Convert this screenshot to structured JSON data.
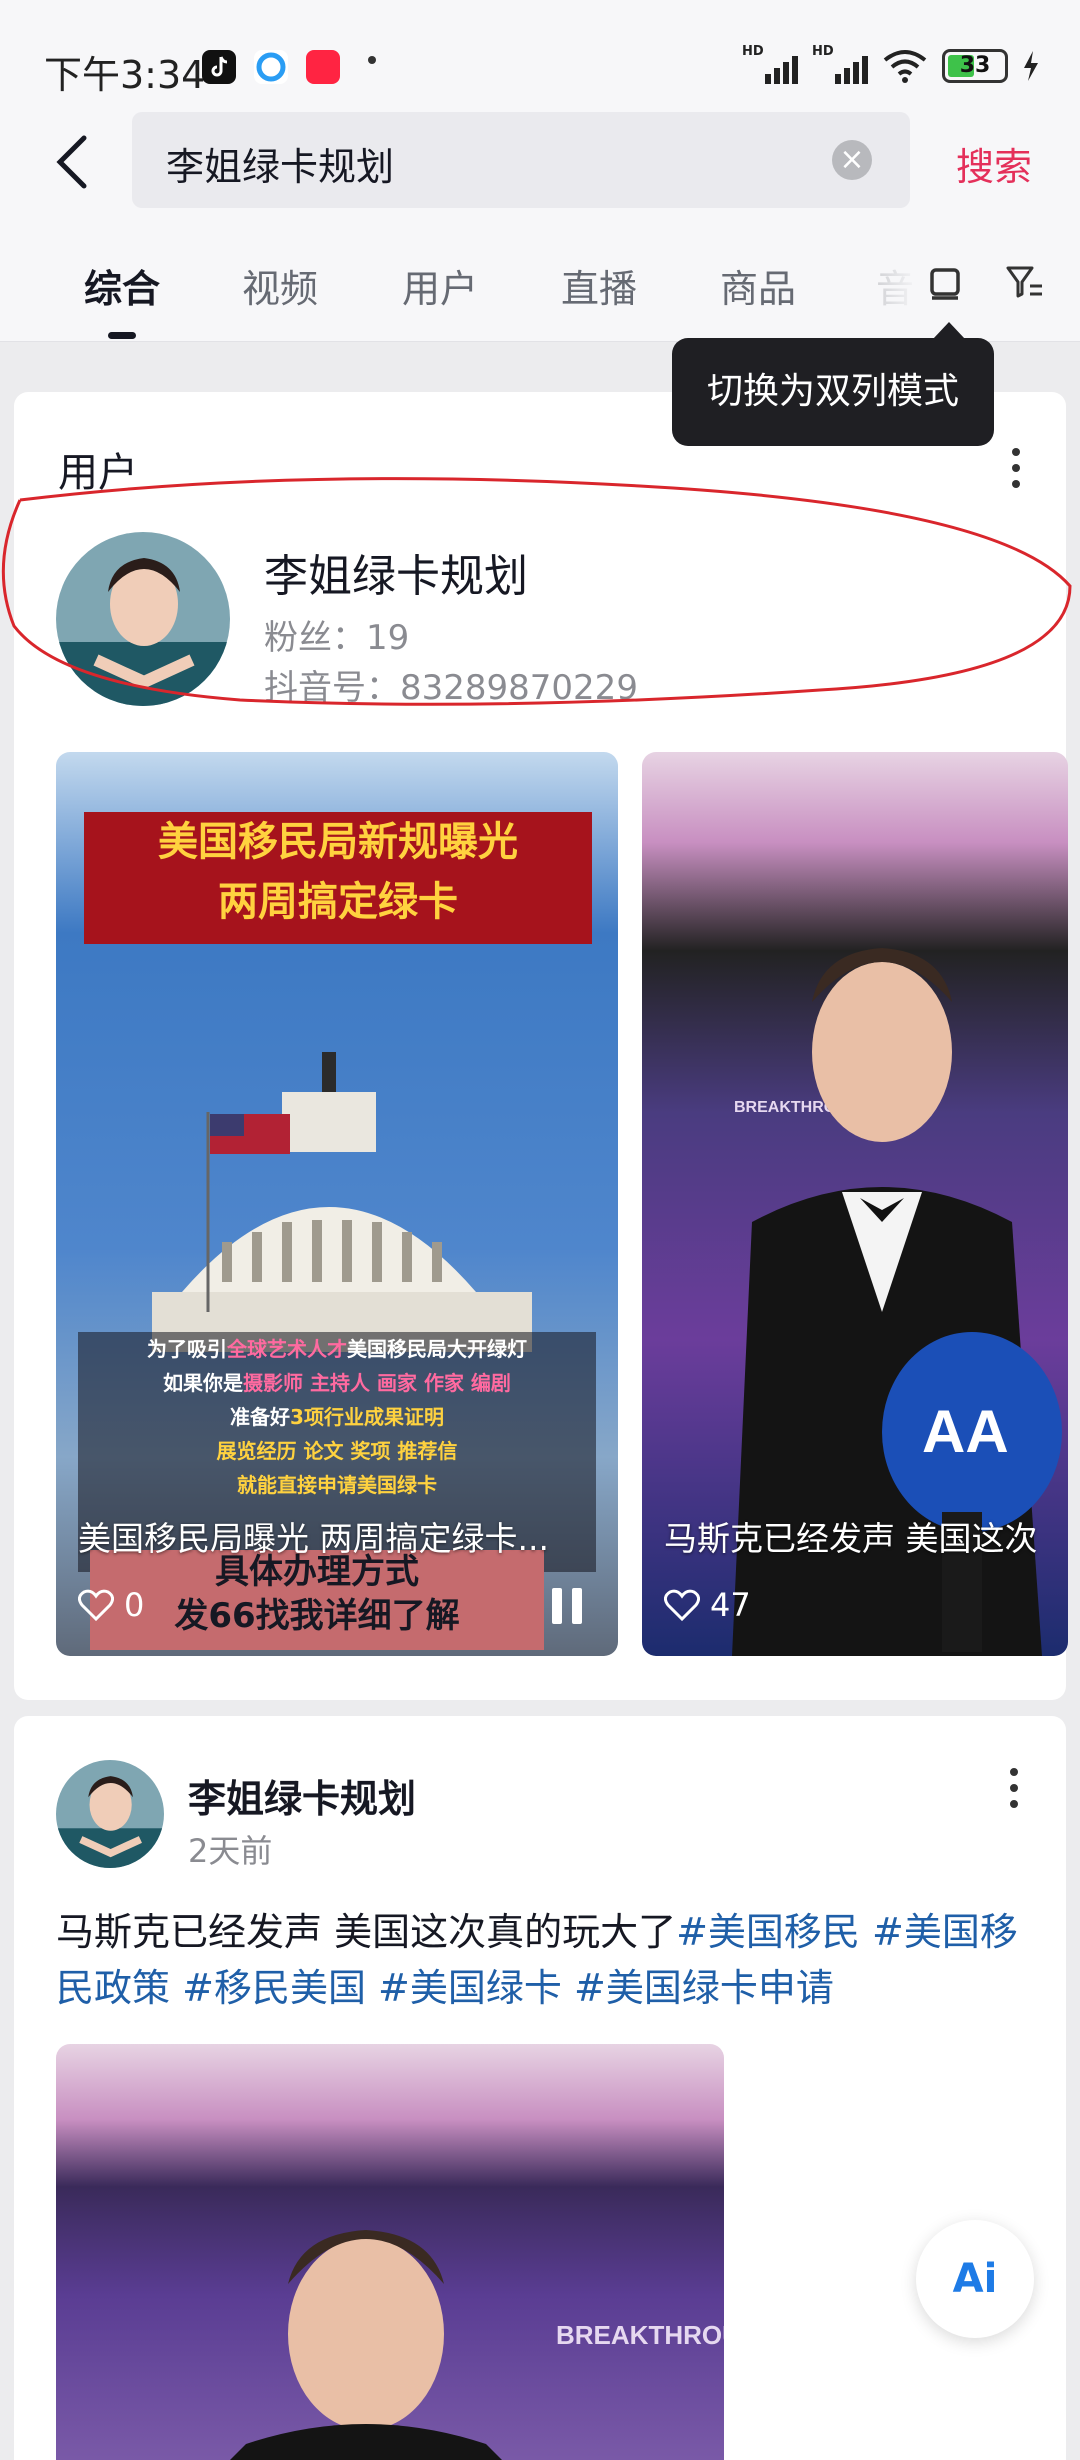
{
  "status_bar": {
    "time": "下午3:34",
    "battery": "33",
    "hd1": "HD",
    "hd2": "HD"
  },
  "search": {
    "query": "李姐绿卡规划",
    "button": "搜索"
  },
  "tabs": [
    {
      "label": "综合",
      "active": true
    },
    {
      "label": "视频"
    },
    {
      "label": "用户"
    },
    {
      "label": "直播"
    },
    {
      "label": "商品"
    },
    {
      "label": "音"
    }
  ],
  "tooltip": "切换为双列模式",
  "user_section": {
    "title": "用户",
    "name": "李姐绿卡规划",
    "fans": "粉丝：19",
    "douyin_id": "抖音号：83289870229"
  },
  "videos": [
    {
      "banner_line1": "美国移民局新规曝光",
      "banner_line2": "两周搞定绿卡",
      "captions": [
        [
          "为了吸引",
          "全球艺术人才",
          "美国移民局大开绿灯"
        ],
        [
          "如果你是",
          "摄影师 主持人 画家 作家 编剧",
          ""
        ],
        [
          "准备好",
          "3项行业成果证明",
          ""
        ],
        [
          "",
          "展览经历 论文 奖项 推荐信",
          ""
        ],
        [
          "就能直接申请美国绿卡",
          "",
          ""
        ]
      ],
      "cta_line1": "具体办理方式",
      "cta_line2": "发66找我详细了解",
      "title": "美国移民局曝光 两周搞定绿卡...",
      "likes": "0"
    },
    {
      "title": "马斯克已经发声 美国这次",
      "likes": "47",
      "mic_logo": "AA",
      "wall_text": "BREAKTHROUGH PRIZE"
    }
  ],
  "post": {
    "author": "李姐绿卡规划",
    "time": "2天前",
    "text_plain": "马斯克已经发声 美国这次真的玩大了",
    "hashtags": [
      "#美国移民",
      "#美国移民政策",
      "#移民美国",
      "#美国绿卡",
      "#美国绿卡申请"
    ],
    "image_wall_text": "BREAKTHROUGH PRIZE"
  },
  "ai_button": "Ai",
  "colors": {
    "accent": "#e4305a",
    "hashtag": "#1f5fa8",
    "annotation": "#d9262c"
  }
}
